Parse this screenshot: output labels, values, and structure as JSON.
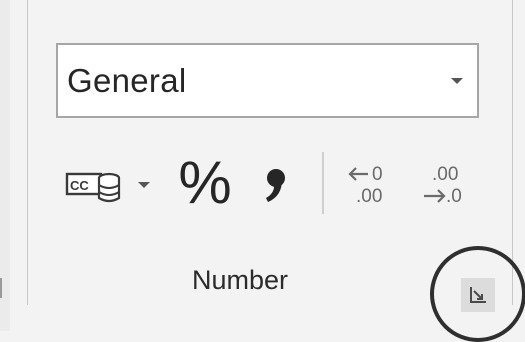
{
  "number_group": {
    "label": "Number",
    "format": {
      "value": "General"
    },
    "percent_symbol": "%",
    "icons": {
      "accounting": "accounting-format-icon",
      "comma": "comma-style-icon",
      "increase_decimal": "increase-decimal-icon",
      "decrease_decimal": "decrease-decimal-icon",
      "launcher": "dialog-launcher-icon"
    }
  },
  "colors": {
    "ribbon_bg": "#f3f3f3",
    "text": "#262626",
    "highlight_ring": "#2f2f2f"
  }
}
